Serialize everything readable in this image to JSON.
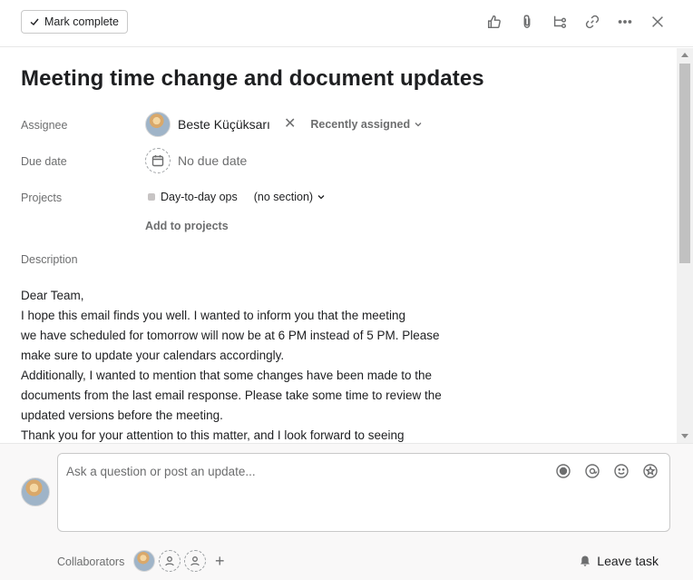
{
  "header": {
    "mark_complete_label": "Mark complete",
    "icons": [
      "like-icon",
      "attachment-icon",
      "subtask-icon",
      "link-icon",
      "more-icon",
      "close-icon"
    ]
  },
  "task": {
    "title": "Meeting time change and document updates",
    "fields": {
      "assignee_label": "Assignee",
      "assignee_name": "Beste Küçüksarı",
      "recently_assigned": "Recently assigned",
      "due_date_label": "Due date",
      "due_date_value": "No due date",
      "projects_label": "Projects",
      "project_name": "Day-to-day ops",
      "section": "(no section)",
      "add_to_projects": "Add to projects",
      "description_label": "Description"
    },
    "description_lines": [
      "Dear Team,",
      "I hope this email finds you well. I wanted to inform you that the meeting",
      "we have scheduled for tomorrow will now be at 6 PM instead of 5 PM. Please",
      "make sure to update your calendars accordingly.",
      "Additionally, I wanted to mention that some changes have been made to the",
      "documents from the last email response. Please take some time to review the",
      "updated versions before the meeting.",
      "Thank you for your attention to this matter, and I look forward to seeing"
    ]
  },
  "composer": {
    "placeholder": "Ask a question or post an update...",
    "collaborators_label": "Collaborators",
    "leave_task_label": "Leave task"
  },
  "colors": {
    "text_primary": "#1e1f21",
    "text_secondary": "#6d6e6f",
    "border": "#c9c9c9",
    "composer_bg": "#f9f8f8"
  }
}
